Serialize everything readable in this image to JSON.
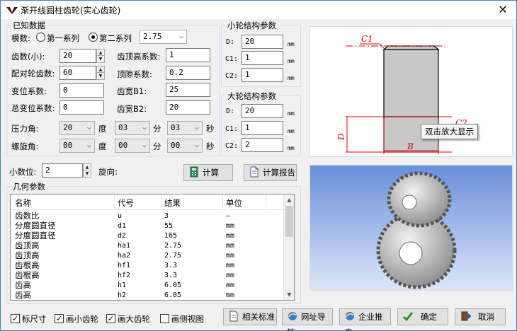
{
  "window": {
    "title": "渐开线圆柱齿轮(实心齿轮)",
    "close": "✕"
  },
  "known": {
    "group_title": "已知数据",
    "module_label": "模数:",
    "radio_series1": "第一系列",
    "radio_series2": "第二系列",
    "module_value": "2.75",
    "teeth_small_label": "齿数(小):",
    "teeth_small_value": "20",
    "addendum_coef_label": "齿顶高系数:",
    "addendum_coef_value": "1",
    "teeth_mating_label": "配对轮齿数:",
    "teeth_mating_value": "60",
    "clearance_coef_label": "顶隙系数:",
    "clearance_coef_value": "0.2",
    "shift_coef_label": "变位系数:",
    "shift_coef_value": "0",
    "width_b1_label": "齿宽B1:",
    "width_b1_value": "25",
    "total_shift_label": "总变位系数:",
    "total_shift_value": "0",
    "width_b2_label": "齿宽B2:",
    "width_b2_value": "20",
    "pressure_label": "压力角:",
    "pressure_deg": "20",
    "pressure_min": "03",
    "pressure_sec": "03",
    "helix_label": "螺旋角:",
    "helix_deg": "00",
    "helix_min": "00",
    "helix_sec": "00",
    "unit_deg": "度",
    "unit_min": "分",
    "unit_sec": "秒"
  },
  "small_wheel": {
    "title": "小轮结构参数",
    "rows": [
      {
        "label": "D:",
        "value": "20",
        "unit": "mm"
      },
      {
        "label": "C1:",
        "value": "1",
        "unit": "mm"
      },
      {
        "label": "C2:",
        "value": "1",
        "unit": "mm"
      }
    ]
  },
  "large_wheel": {
    "title": "大轮结构参数",
    "rows": [
      {
        "label": "D:",
        "value": "20",
        "unit": "mm"
      },
      {
        "label": "C1:",
        "value": "1",
        "unit": "mm"
      },
      {
        "label": "C2:",
        "value": "2",
        "unit": "mm"
      }
    ]
  },
  "decimals": {
    "label": "小数位:",
    "value": "2",
    "rotate_label": "旋向:"
  },
  "buttons": {
    "calculate": "计算",
    "report": "计算报告",
    "standards": "相关标准",
    "web_nav": "网址导航",
    "promo": "企业推广",
    "ok": "确定",
    "cancel": "取消"
  },
  "geometry": {
    "group_title": "几何参数",
    "columns": [
      "名称",
      "代号",
      "结果",
      "单位"
    ],
    "rows": [
      [
        "齿数比",
        "u",
        "3",
        "—"
      ],
      [
        "分度圆直径",
        "d1",
        "55",
        "mm"
      ],
      [
        "分度圆直径",
        "d2",
        "165",
        "mm"
      ],
      [
        "齿顶高",
        "ha1",
        "2.75",
        "mm"
      ],
      [
        "齿顶高",
        "ha2",
        "2.75",
        "mm"
      ],
      [
        "齿根高",
        "hf1",
        "3.3",
        "mm"
      ],
      [
        "齿根高",
        "hf2",
        "3.3",
        "mm"
      ],
      [
        "齿高",
        "h1",
        "6.05",
        "mm"
      ],
      [
        "齿高",
        "h2",
        "6.05",
        "mm"
      ]
    ]
  },
  "checks": {
    "dimensions": {
      "label": "标尺寸",
      "checked": true
    },
    "draw_small": {
      "label": "画小齿轮",
      "checked": true
    },
    "draw_large": {
      "label": "画大齿轮",
      "checked": true
    },
    "side_view": {
      "label": "画侧视图",
      "checked": false
    }
  },
  "drawing": {
    "c1": "C1",
    "c2": "C2",
    "d": "D",
    "b": "B"
  },
  "tooltip": "双击放大显示",
  "colors": {
    "dim_red": "#e00000",
    "blueprint_fill": "#c8c8c8",
    "render_bg": "#7d9fe0"
  }
}
